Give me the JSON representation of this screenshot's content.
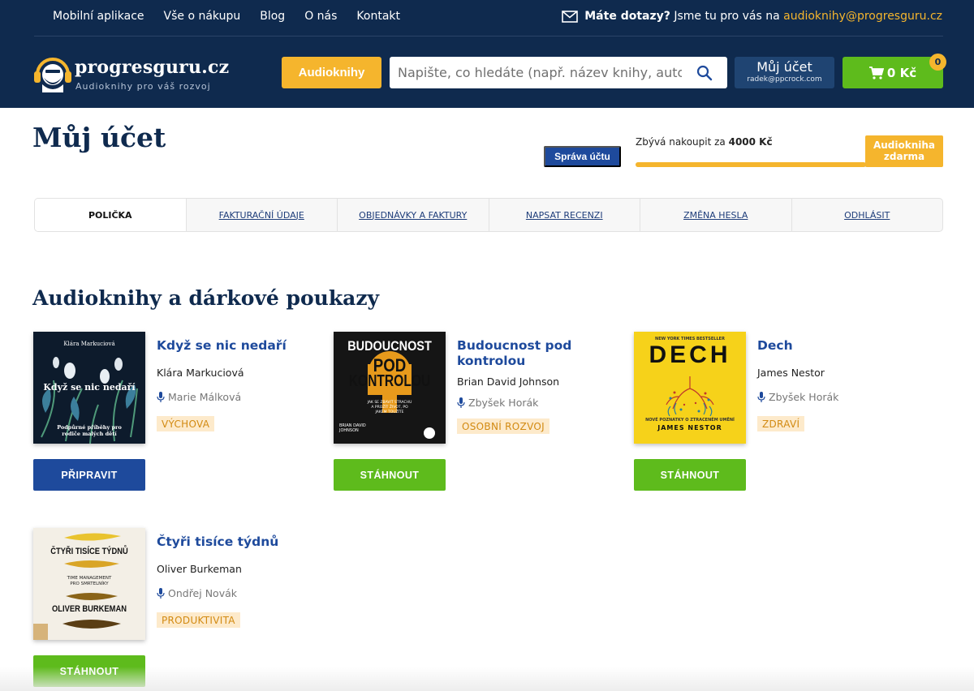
{
  "topnav": {
    "items": [
      "Mobilní aplikace",
      "Vše o nákupu",
      "Blog",
      "O nás",
      "Kontakt"
    ]
  },
  "contact": {
    "question": "Máte dotazy?",
    "text": "Jsme tu pro vás na",
    "email": "audioknihy@progresguru.cz"
  },
  "logo": {
    "name": "progresguru.cz",
    "tagline": "Audioknihy pro váš rozvoj"
  },
  "header": {
    "audiobooks_label": "Audioknihy",
    "search_placeholder": "Napište, co hledáte (např. název knihy, autora ..)",
    "account_label": "Můj účet",
    "account_email": "radek@ppcrock.com",
    "cart_label": "0 Kč",
    "cart_count": "0"
  },
  "page": {
    "title": "Můj účet",
    "manage_label": "Správa účtu",
    "remaining_prefix": "Zbývá nakoupit za",
    "remaining_amount": "4000 Kč",
    "gift_line1": "Audiokniha",
    "gift_line2": "zdarma"
  },
  "tabs": [
    {
      "label": "POLIČKA",
      "active": true
    },
    {
      "label": "FAKTURAČNÍ ÚDAJE",
      "active": false
    },
    {
      "label": "OBJEDNÁVKY A FAKTURY",
      "active": false
    },
    {
      "label": "NAPSAT RECENZI",
      "active": false
    },
    {
      "label": "ZMĚNA HESLA",
      "active": false
    },
    {
      "label": "ODHLÁSIT",
      "active": false
    }
  ],
  "section": {
    "title": "Audioknihy a dárkové poukazy"
  },
  "books": [
    {
      "title": "Když se nic nedaří",
      "author": "Klára Markuciová",
      "narrator": "Marie Málková",
      "tag": "VÝCHOVA",
      "button": "PŘIPRAVIT",
      "cover": {
        "author": "Klára Markuciová",
        "title": "Když se nic nedaří",
        "subtitle": "Podpůrné příběhy pro rodiče malých dětí"
      }
    },
    {
      "title": "Budoucnost pod kontrolou",
      "author": "Brian David Johnson",
      "narrator": "Zbyšek Horák",
      "tag": "OSOBNÍ ROZVOJ",
      "button": "STÁHNOUT",
      "cover": {
        "line1": "BUDOUCNOST",
        "line2": "POD",
        "line3": "KONTROLOU",
        "subtitle": "JAK SE ZBAVIT STRACHU A PROŽÍT ŽIVOT, PO JAKÉM TOUŽÍTE",
        "author": "BRIAN DAVID JOHNSON"
      }
    },
    {
      "title": "Dech",
      "author": "James Nestor",
      "narrator": "Zbyšek Horák",
      "tag": "ZDRAVÍ",
      "button": "STÁHNOUT",
      "cover": {
        "top": "NEW YORK TIMES BESTSELLER",
        "title": "DECH",
        "subtitle": "NOVÉ POZNATKY O ZTRACENÉM UMĚNÍ",
        "author": "JAMES NESTOR"
      }
    },
    {
      "title": "Čtyři tisíce týdnů",
      "author": "Oliver Burkeman",
      "narrator": "Ondřej Novák",
      "tag": "PRODUKTIVITA",
      "button": "STÁHNOUT",
      "cover": {
        "title": "ČTYŘI TISÍCE TÝDNŮ",
        "subtitle1": "TIME MANAGEMENT",
        "subtitle2": "PRO SMRTELNÍKY",
        "author": "OLIVER BURKEMAN"
      }
    }
  ],
  "progress": {
    "fraction": 0.75
  },
  "colors": {
    "navy": "#0f2a4e",
    "yellow": "#f5b52d",
    "green": "#5ebb1c",
    "blue": "#1e4a9c"
  }
}
